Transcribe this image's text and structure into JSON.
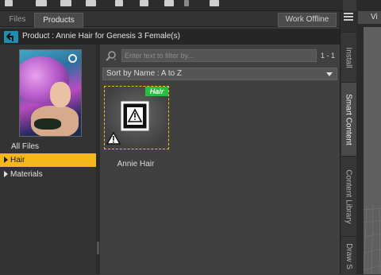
{
  "tabs": [
    {
      "label": "Files",
      "active": false
    },
    {
      "label": "Products",
      "active": true
    }
  ],
  "work_offline_label": "Work Offline",
  "product_header": "Product :  Annie Hair for Genesis 3 Female(s)",
  "categories": [
    {
      "label": "All Files",
      "selected": false,
      "expandable": false
    },
    {
      "label": "Hair",
      "selected": true,
      "expandable": true
    },
    {
      "label": "Materials",
      "selected": false,
      "expandable": true
    }
  ],
  "search": {
    "placeholder": "Enter text to filter by...",
    "value": ""
  },
  "result_count": "1 - 1",
  "sort": {
    "selected": "Sort by Name : A to Z"
  },
  "items": [
    {
      "label": "Annie Hair",
      "tag": "Hair",
      "icon": "warning-icon"
    }
  ],
  "side_tabs": [
    {
      "label": "Install",
      "active": false
    },
    {
      "label": "Smart Content",
      "active": true
    },
    {
      "label": "Content Library",
      "active": false
    },
    {
      "label": "Draw S",
      "active": false
    }
  ],
  "viewport_tab": "Vi",
  "colors": {
    "selection": "#f5b81c",
    "tag_green": "#22c13c",
    "back_button": "#1f8fb0"
  }
}
